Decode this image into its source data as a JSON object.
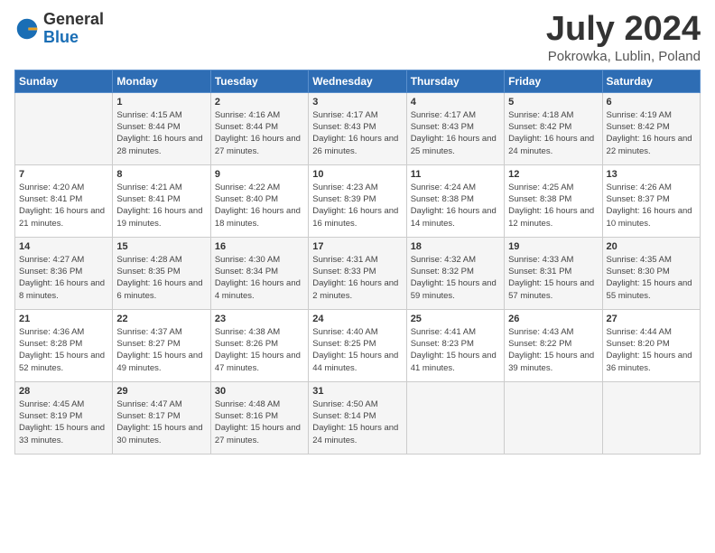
{
  "logo": {
    "general": "General",
    "blue": "Blue"
  },
  "title": "July 2024",
  "subtitle": "Pokrowka, Lublin, Poland",
  "days": [
    "Sunday",
    "Monday",
    "Tuesday",
    "Wednesday",
    "Thursday",
    "Friday",
    "Saturday"
  ],
  "weeks": [
    [
      {
        "date": "",
        "content": ""
      },
      {
        "date": "1",
        "content": "Sunrise: 4:15 AM\nSunset: 8:44 PM\nDaylight: 16 hours and 28 minutes."
      },
      {
        "date": "2",
        "content": "Sunrise: 4:16 AM\nSunset: 8:44 PM\nDaylight: 16 hours and 27 minutes."
      },
      {
        "date": "3",
        "content": "Sunrise: 4:17 AM\nSunset: 8:43 PM\nDaylight: 16 hours and 26 minutes."
      },
      {
        "date": "4",
        "content": "Sunrise: 4:17 AM\nSunset: 8:43 PM\nDaylight: 16 hours and 25 minutes."
      },
      {
        "date": "5",
        "content": "Sunrise: 4:18 AM\nSunset: 8:42 PM\nDaylight: 16 hours and 24 minutes."
      },
      {
        "date": "6",
        "content": "Sunrise: 4:19 AM\nSunset: 8:42 PM\nDaylight: 16 hours and 22 minutes."
      }
    ],
    [
      {
        "date": "7",
        "content": "Sunrise: 4:20 AM\nSunset: 8:41 PM\nDaylight: 16 hours and 21 minutes."
      },
      {
        "date": "8",
        "content": "Sunrise: 4:21 AM\nSunset: 8:41 PM\nDaylight: 16 hours and 19 minutes."
      },
      {
        "date": "9",
        "content": "Sunrise: 4:22 AM\nSunset: 8:40 PM\nDaylight: 16 hours and 18 minutes."
      },
      {
        "date": "10",
        "content": "Sunrise: 4:23 AM\nSunset: 8:39 PM\nDaylight: 16 hours and 16 minutes."
      },
      {
        "date": "11",
        "content": "Sunrise: 4:24 AM\nSunset: 8:38 PM\nDaylight: 16 hours and 14 minutes."
      },
      {
        "date": "12",
        "content": "Sunrise: 4:25 AM\nSunset: 8:38 PM\nDaylight: 16 hours and 12 minutes."
      },
      {
        "date": "13",
        "content": "Sunrise: 4:26 AM\nSunset: 8:37 PM\nDaylight: 16 hours and 10 minutes."
      }
    ],
    [
      {
        "date": "14",
        "content": "Sunrise: 4:27 AM\nSunset: 8:36 PM\nDaylight: 16 hours and 8 minutes."
      },
      {
        "date": "15",
        "content": "Sunrise: 4:28 AM\nSunset: 8:35 PM\nDaylight: 16 hours and 6 minutes."
      },
      {
        "date": "16",
        "content": "Sunrise: 4:30 AM\nSunset: 8:34 PM\nDaylight: 16 hours and 4 minutes."
      },
      {
        "date": "17",
        "content": "Sunrise: 4:31 AM\nSunset: 8:33 PM\nDaylight: 16 hours and 2 minutes."
      },
      {
        "date": "18",
        "content": "Sunrise: 4:32 AM\nSunset: 8:32 PM\nDaylight: 15 hours and 59 minutes."
      },
      {
        "date": "19",
        "content": "Sunrise: 4:33 AM\nSunset: 8:31 PM\nDaylight: 15 hours and 57 minutes."
      },
      {
        "date": "20",
        "content": "Sunrise: 4:35 AM\nSunset: 8:30 PM\nDaylight: 15 hours and 55 minutes."
      }
    ],
    [
      {
        "date": "21",
        "content": "Sunrise: 4:36 AM\nSunset: 8:28 PM\nDaylight: 15 hours and 52 minutes."
      },
      {
        "date": "22",
        "content": "Sunrise: 4:37 AM\nSunset: 8:27 PM\nDaylight: 15 hours and 49 minutes."
      },
      {
        "date": "23",
        "content": "Sunrise: 4:38 AM\nSunset: 8:26 PM\nDaylight: 15 hours and 47 minutes."
      },
      {
        "date": "24",
        "content": "Sunrise: 4:40 AM\nSunset: 8:25 PM\nDaylight: 15 hours and 44 minutes."
      },
      {
        "date": "25",
        "content": "Sunrise: 4:41 AM\nSunset: 8:23 PM\nDaylight: 15 hours and 41 minutes."
      },
      {
        "date": "26",
        "content": "Sunrise: 4:43 AM\nSunset: 8:22 PM\nDaylight: 15 hours and 39 minutes."
      },
      {
        "date": "27",
        "content": "Sunrise: 4:44 AM\nSunset: 8:20 PM\nDaylight: 15 hours and 36 minutes."
      }
    ],
    [
      {
        "date": "28",
        "content": "Sunrise: 4:45 AM\nSunset: 8:19 PM\nDaylight: 15 hours and 33 minutes."
      },
      {
        "date": "29",
        "content": "Sunrise: 4:47 AM\nSunset: 8:17 PM\nDaylight: 15 hours and 30 minutes."
      },
      {
        "date": "30",
        "content": "Sunrise: 4:48 AM\nSunset: 8:16 PM\nDaylight: 15 hours and 27 minutes."
      },
      {
        "date": "31",
        "content": "Sunrise: 4:50 AM\nSunset: 8:14 PM\nDaylight: 15 hours and 24 minutes."
      },
      {
        "date": "",
        "content": ""
      },
      {
        "date": "",
        "content": ""
      },
      {
        "date": "",
        "content": ""
      }
    ]
  ]
}
